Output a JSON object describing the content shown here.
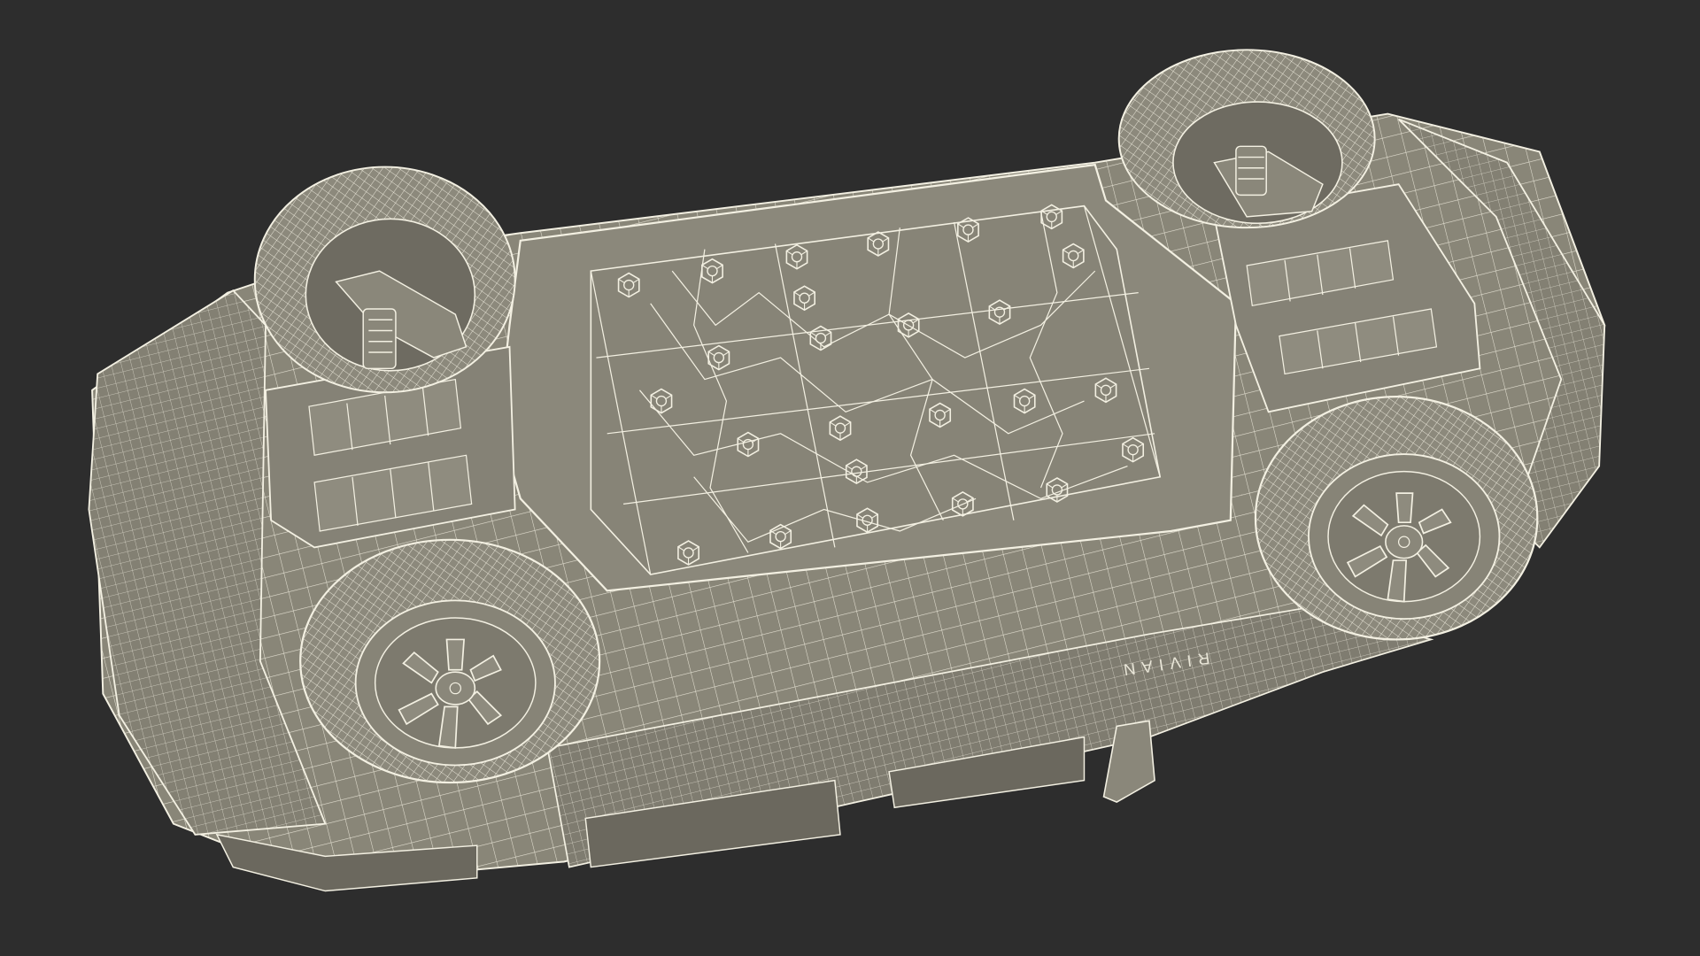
{
  "scene": {
    "background_color": "#2d2d2d",
    "body_color": "#898678",
    "wire_color": "#f3f0e2",
    "shadow_color": "#5f5c52",
    "tire_color": "#8c897c",
    "subject": "pickup-truck-underside-wireframe-render"
  },
  "vehicle": {
    "badge_text": "RIVIAN",
    "wheel_count": 4
  }
}
